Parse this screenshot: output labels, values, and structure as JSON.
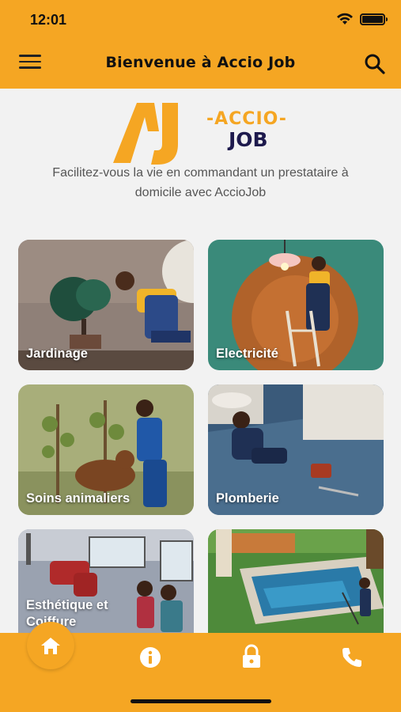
{
  "status_bar": {
    "time": "12:01"
  },
  "header": {
    "title": "Bienvenue à Accio Job",
    "menu_icon": "hamburger-menu-icon",
    "search_icon": "search-icon"
  },
  "logo": {
    "monogram": "AJ",
    "accio": "-ACCIO-",
    "job": "JOB"
  },
  "tagline": {
    "line1": "Facilitez-vous la vie en commandant un prestataire à",
    "line2": "domicile avec AccioJob"
  },
  "categories": [
    {
      "label": "Jardinage"
    },
    {
      "label": "Electricité"
    },
    {
      "label": "Soins animaliers"
    },
    {
      "label": "Plomberie"
    },
    {
      "label": "Esthétique et Coiffure"
    },
    {
      "label": ""
    }
  ],
  "bottom_nav": {
    "items": [
      "home-icon",
      "info-icon",
      "lock-icon",
      "phone-icon"
    ]
  },
  "colors": {
    "accent": "#f5a623",
    "navy": "#1e1a4d",
    "background": "#f2f2f2"
  }
}
